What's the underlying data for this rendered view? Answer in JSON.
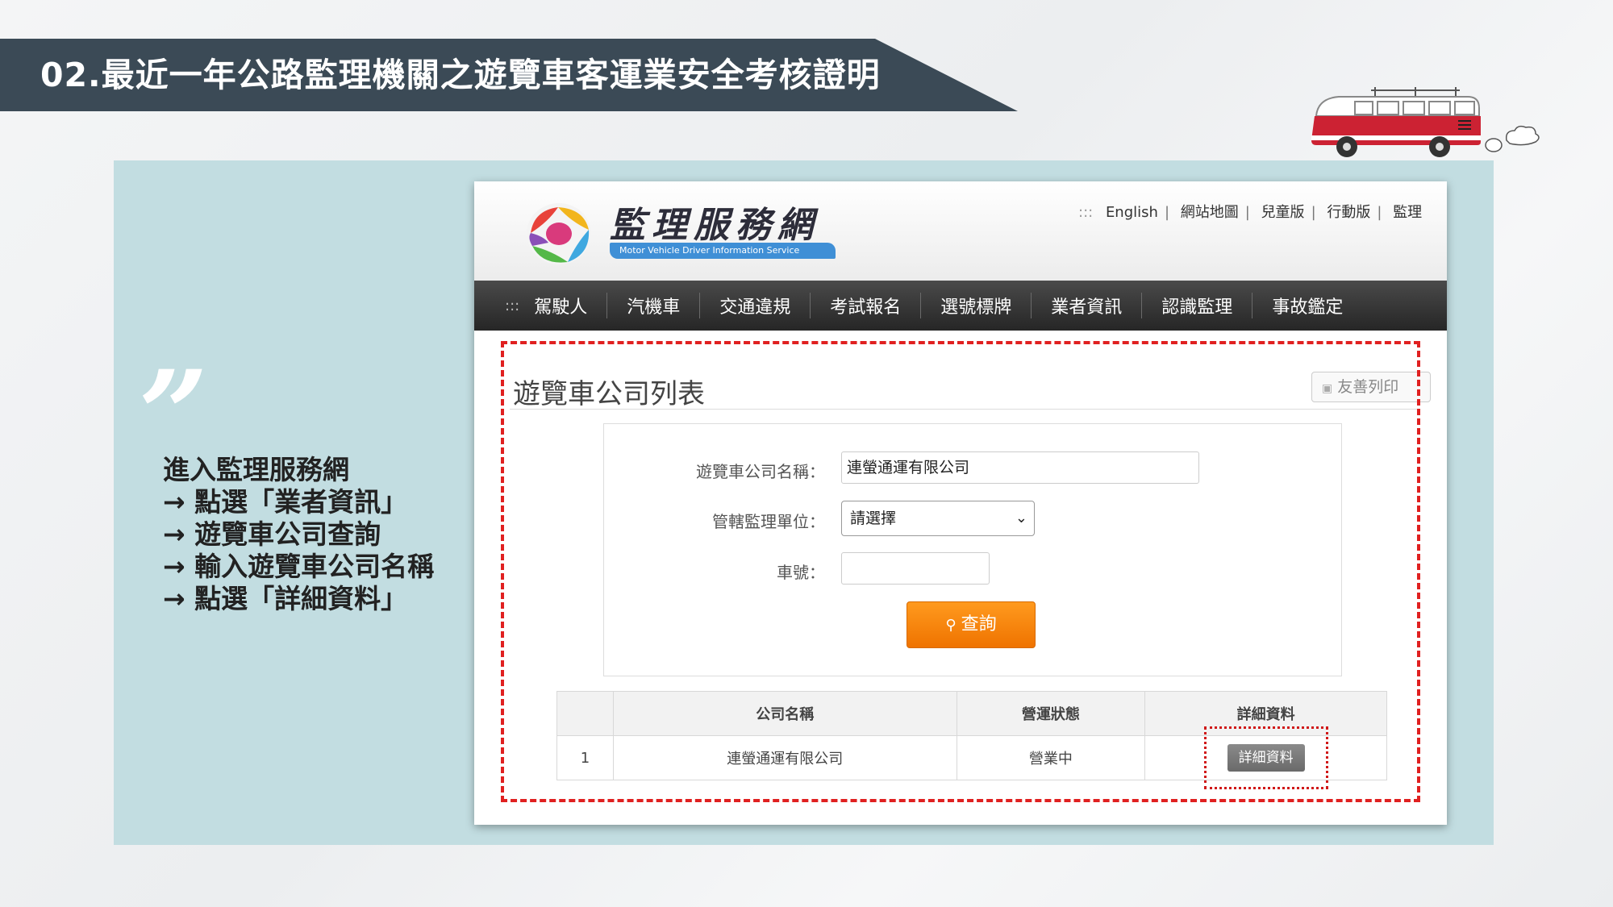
{
  "slide": {
    "title": "02.最近一年公路監理機關之遊覽車客運業安全考核證明",
    "quote_mark": "”",
    "steps": [
      "進入監理服務網",
      "→ 點選「業者資訊」",
      "→ 遊覽車公司查詢",
      "→ 輸入遊覽車公司名稱",
      "→ 點選「詳細資料」"
    ]
  },
  "site": {
    "logo_text": "監理服務網",
    "logo_subtitle": "Motor Vehicle Driver Information Service",
    "top_links_prefix": ":::",
    "top_links": [
      "English",
      "網站地圖",
      "兒童版",
      "行動版",
      "監理"
    ],
    "menu_prefix": ":::",
    "menu": [
      "駕駛人",
      "汽機車",
      "交通違規",
      "考試報名",
      "選號標牌",
      "業者資訊",
      "認識監理",
      "事故鑑定"
    ]
  },
  "page": {
    "title": "遊覽車公司列表",
    "print_label": "友善列印",
    "form": {
      "company_label": "遊覽車公司名稱：",
      "company_value": "連螢通運有限公司",
      "unit_label": "管轄監理單位：",
      "unit_value": "請選擇",
      "plate_label": "車號：",
      "plate_value": "",
      "search_label": "查詢"
    },
    "table": {
      "headers": [
        "",
        "公司名稱",
        "營運狀態",
        "詳細資料"
      ],
      "rows": [
        {
          "index": "1",
          "company": "連螢通運有限公司",
          "status": "營業中",
          "detail": "詳細資料"
        }
      ]
    }
  },
  "colors": {
    "title_band": "#3b4a56",
    "panel": "#c2dde1",
    "menubar": "#2f2f2f",
    "search_button": "#f58400",
    "highlight": "#e02020"
  }
}
